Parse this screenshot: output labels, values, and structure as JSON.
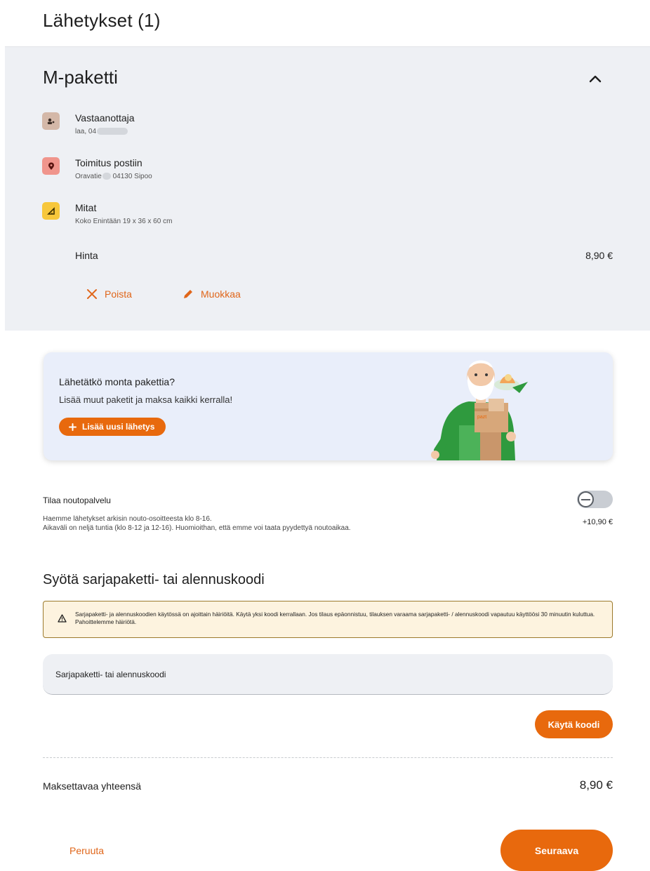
{
  "page": {
    "title": "Lähetykset (1)"
  },
  "shipment": {
    "title": "M-paketti",
    "recipient": {
      "label": "Vastaanottaja",
      "detail_prefix": "laa, 04"
    },
    "delivery": {
      "label": "Toimitus postiin",
      "detail_prefix": "Oravatie",
      "detail_suffix": "04130 Sipoo"
    },
    "dimensions": {
      "label": "Mitat",
      "detail": "Koko Enintään 19 x 36 x 60 cm"
    },
    "price_label": "Hinta",
    "price_value": "8,90 €",
    "actions": {
      "remove": "Poista",
      "edit": "Muokkaa"
    }
  },
  "promo": {
    "title": "Lähetätkö monta pakettia?",
    "text": "Lisää muut paketit ja maksa kaikki kerralla!",
    "button": "Lisää uusi lähetys",
    "box_label": "pazt"
  },
  "pickup": {
    "title": "Tilaa noutopalvelu",
    "desc_line1": "Haemme lähetykset arkisin nouto-osoitteesta klo 8-16.",
    "desc_line2": "Aikaväli on neljä tuntia (klo 8-12 ja 12-16). Huomioithan, että emme voi taata pyydettyä noutoaikaa.",
    "price": "+10,90 €",
    "enabled": false
  },
  "discount": {
    "heading": "Syötä sarjapaketti- tai alennuskoodi",
    "warning": "Sarjapaketti- ja alennuskoodien käytössä on ajoittain häiriöitä. Käytä yksi koodi kerrallaan. Jos tilaus epäonnistuu, tilauksen varaama sarjapaketti- / alennuskoodi vapautuu käyttöösi 30 minuutin kuluttua. Pahoittelemme häiriötä.",
    "placeholder": "Sarjapaketti- tai alennuskoodi",
    "apply_button": "Käytä koodi"
  },
  "total": {
    "label": "Maksettavaa yhteensä",
    "value": "8,90 €"
  },
  "footer": {
    "cancel": "Peruuta",
    "next": "Seuraava"
  },
  "colors": {
    "accent": "#e8690d",
    "card_bg": "#eef0f4",
    "promo_bg": "#e9eefa",
    "warning_bg": "#fdf3df"
  }
}
